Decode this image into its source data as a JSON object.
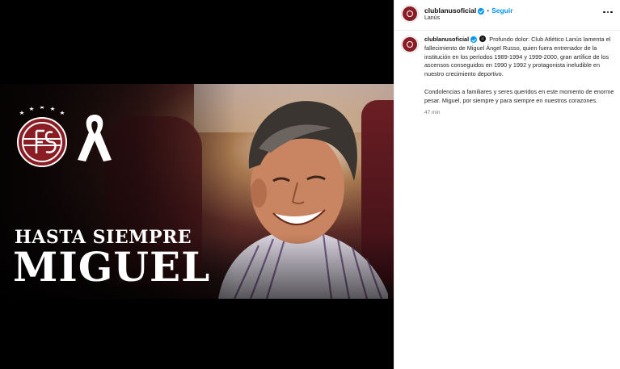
{
  "image": {
    "headline_top": "HASTA SIEMPRE",
    "headline_name": "MIGUEL"
  },
  "header": {
    "username": "clublanusoficial",
    "separator": "•",
    "follow_label": "Seguir",
    "location": "Lanús"
  },
  "caption": {
    "username": "clublanusoficial",
    "paragraph1": "Profundo dolor: Club Atlético Lanús lamenta el fallecimiento de Miguel Ángel Russo, quien fuera entrenador de la institución en los períodos 1989-1994 y 1999-2000, gran artífice de los ascensos conseguidos en 1990 y 1992 y protagonista ineludible en nuestro crecimiento deportivo.",
    "paragraph2": "Condolencias a familiares y seres queridos en este momento de enorme pesar. Miguel, por siempre y para siempre en nuestros corazones.",
    "timestamp": "47 min"
  },
  "colors": {
    "brand": "#8a1c24",
    "link": "#0095f6",
    "verified": "#0095f6"
  }
}
